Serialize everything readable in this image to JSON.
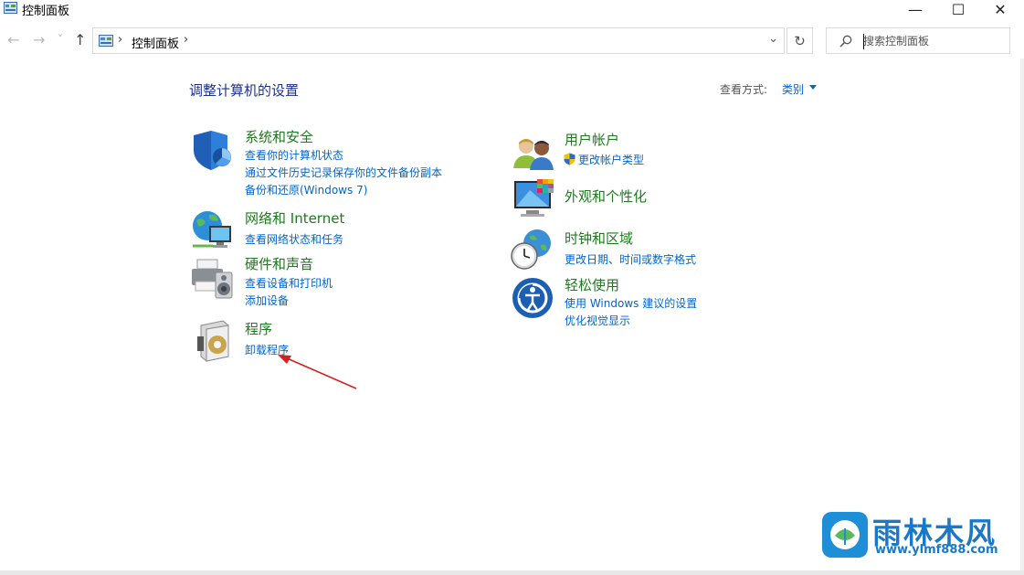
{
  "window": {
    "title": "控制面板",
    "minimize_glyph": "—",
    "maximize_glyph": "☐",
    "close_glyph": "✕"
  },
  "address_bar": {
    "back_glyph": "←",
    "forward_glyph": "→",
    "history_glyph": "˅",
    "up_glyph": "↑",
    "separator": "›",
    "breadcrumb": "控制面板",
    "dropdown_glyph": "⌄",
    "refresh_glyph": "↻"
  },
  "search": {
    "placeholder": "搜索控制面板"
  },
  "page": {
    "heading": "调整计算机的设置",
    "view_by_label": "查看方式:",
    "view_by_value": "类别"
  },
  "categories": [
    {
      "icon": "security-shield-icon",
      "title": "系统和安全",
      "links": [
        "查看你的计算机状态",
        "通过文件历史记录保存你的文件备份副本",
        "备份和还原(Windows 7)"
      ]
    },
    {
      "icon": "network-globe-icon",
      "title": "网络和 Internet",
      "links": [
        "查看网络状态和任务"
      ]
    },
    {
      "icon": "printer-speaker-icon",
      "title": "硬件和声音",
      "links": [
        "查看设备和打印机",
        "添加设备"
      ]
    },
    {
      "icon": "programs-disc-icon",
      "title": "程序",
      "links": [
        "卸载程序"
      ]
    },
    {
      "icon": "users-icon",
      "title": "用户帐户",
      "links": [
        "更改帐户类型"
      ]
    },
    {
      "icon": "appearance-monitor-icon",
      "title": "外观和个性化",
      "links": []
    },
    {
      "icon": "clock-globe-icon",
      "title": "时钟和区域",
      "links": [
        "更改日期、时间或数字格式"
      ]
    },
    {
      "icon": "ease-of-access-icon",
      "title": "轻松使用",
      "links": [
        "使用 Windows 建议的设置",
        "优化视觉显示"
      ]
    }
  ],
  "watermark": {
    "title": "雨林木风",
    "url": "www.ylmf888.com"
  },
  "colors": {
    "heading": "#1e3287",
    "category_title": "#1e7a1e",
    "link": "#0066cc",
    "annotation_arrow": "#d42020"
  }
}
